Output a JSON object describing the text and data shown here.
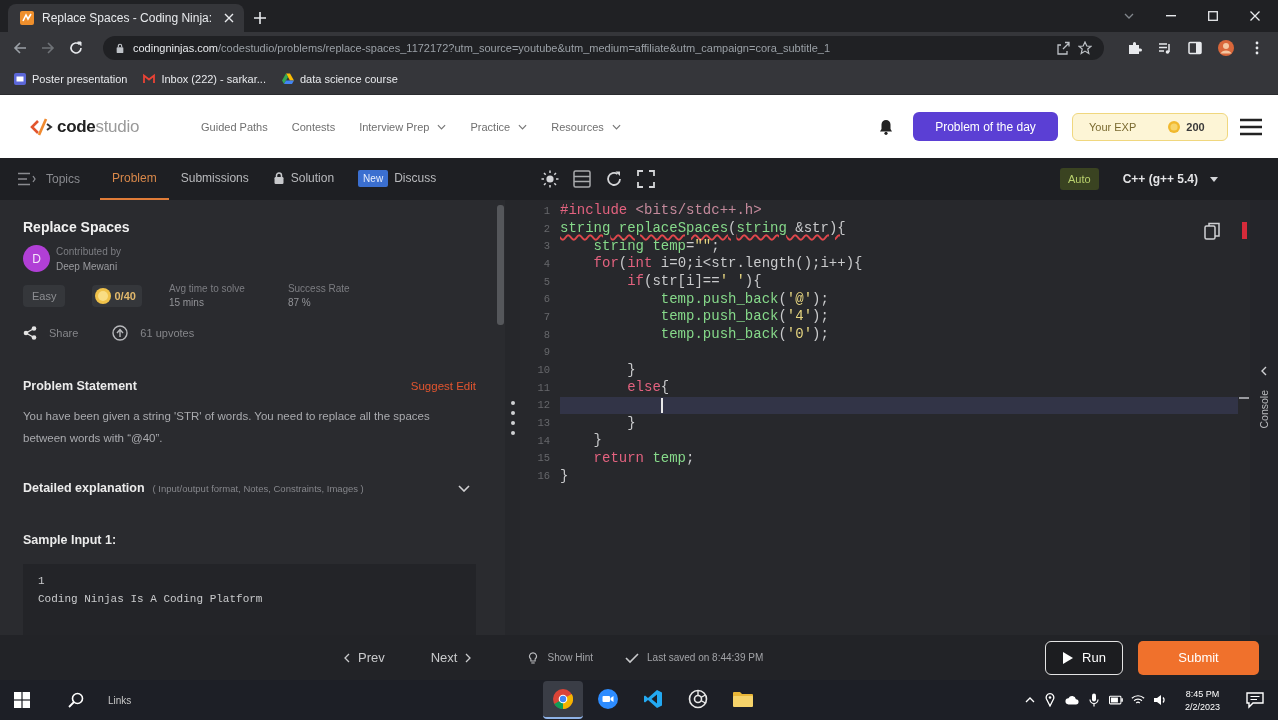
{
  "browser": {
    "tab_title": "Replace Spaces - Coding Ninja:",
    "url_host": "codingninjas.com",
    "url_path": "/codestudio/problems/replace-spaces_1172172?utm_source=youtube&utm_medium=affiliate&utm_campaign=cora_subtitle_1",
    "bookmarks": [
      {
        "label": "Poster presentation",
        "kind": "slides"
      },
      {
        "label": "Inbox (222) - sarkar...",
        "kind": "mail"
      },
      {
        "label": "data science course",
        "kind": "drive"
      }
    ]
  },
  "site_header": {
    "logo": "**code**studio",
    "nav": [
      {
        "label": "Guided Paths",
        "dropdown": false
      },
      {
        "label": "Contests",
        "dropdown": false
      },
      {
        "label": "Interview Prep",
        "dropdown": true
      },
      {
        "label": "Practice",
        "dropdown": true
      },
      {
        "label": "Resources",
        "dropdown": true
      }
    ],
    "problem_of_day": "Problem of the day",
    "exp_label": "Your EXP",
    "exp_value": "200"
  },
  "toolbar": {
    "topics": "Topics",
    "tabs": [
      {
        "label": "Problem",
        "selected": true,
        "locked": false
      },
      {
        "label": "Submissions",
        "selected": false,
        "locked": false
      },
      {
        "label": "Solution",
        "selected": false,
        "locked": true
      },
      {
        "label": "Discuss",
        "selected": false,
        "locked": false,
        "badge": "New"
      }
    ],
    "mode": "Auto",
    "language": "C++ (g++ 5.4)"
  },
  "problem": {
    "title": "Replace Spaces",
    "author": {
      "initial": "D",
      "caption": "Contributed by",
      "name": "Deep Mewani"
    },
    "difficulty": "Easy",
    "score": "0/40",
    "stats": [
      {
        "label": "Avg time to solve",
        "value": "15 mins"
      },
      {
        "label": "Success Rate",
        "value": "87 %"
      }
    ],
    "share": "Share",
    "upvotes": "61 upvotes",
    "statement_heading": "Problem Statement",
    "suggest_edit": "Suggest Edit",
    "statement": "You have been given a string 'STR' of words. You need to replace all the spaces between words with “@40”.",
    "details": {
      "label": "Detailed explanation",
      "hint": "( Input/output format, Notes, Constraints, Images )",
      "expanded": false
    },
    "sample_heading": "Sample Input 1:",
    "sample_lines": [
      "1",
      "Coding Ninjas Is A Coding Platform"
    ]
  },
  "editor": {
    "lines": [
      {
        "number": "1",
        "current": false,
        "error": false,
        "tokens": [
          {
            "text": "#include",
            "kind": "directive"
          },
          {
            "text": " <bits/stdc++.h>",
            "kind": "header"
          }
        ]
      },
      {
        "number": "2",
        "current": false,
        "error": true,
        "tokens": [
          {
            "text": "string",
            "kind": "identifier"
          },
          {
            "text": " replaceSpaces",
            "kind": "identifier"
          },
          {
            "text": "(",
            "kind": "punct"
          },
          {
            "text": "string",
            "kind": "identifier"
          },
          {
            "text": " &str){",
            "kind": "punct"
          }
        ]
      },
      {
        "number": "3",
        "current": false,
        "error": false,
        "tokens": [
          {
            "text": "    string",
            "kind": "identifier"
          },
          {
            "text": " temp",
            "kind": "identifier"
          },
          {
            "text": "=",
            "kind": "punct"
          },
          {
            "text": "\"\"",
            "kind": "string"
          },
          {
            "text": ";",
            "kind": "punct"
          }
        ]
      },
      {
        "number": "4",
        "current": false,
        "error": false,
        "tokens": [
          {
            "text": "    for",
            "kind": "keyword"
          },
          {
            "text": "(",
            "kind": "punct"
          },
          {
            "text": "int",
            "kind": "keyword"
          },
          {
            "text": " i=0;i<str.length();i++){",
            "kind": "punct"
          }
        ]
      },
      {
        "number": "5",
        "current": false,
        "error": false,
        "tokens": [
          {
            "text": "        if",
            "kind": "keyword"
          },
          {
            "text": "(str[i]==",
            "kind": "punct"
          },
          {
            "text": "' '",
            "kind": "string"
          },
          {
            "text": "){",
            "kind": "punct"
          }
        ]
      },
      {
        "number": "6",
        "current": false,
        "error": false,
        "tokens": [
          {
            "text": "            temp.push_back",
            "kind": "identifier"
          },
          {
            "text": "(",
            "kind": "punct"
          },
          {
            "text": "'@'",
            "kind": "string"
          },
          {
            "text": ");",
            "kind": "punct"
          }
        ]
      },
      {
        "number": "7",
        "current": false,
        "error": false,
        "tokens": [
          {
            "text": "            temp.push_back",
            "kind": "identifier"
          },
          {
            "text": "(",
            "kind": "punct"
          },
          {
            "text": "'4'",
            "kind": "string"
          },
          {
            "text": ");",
            "kind": "punct"
          }
        ]
      },
      {
        "number": "8",
        "current": false,
        "error": false,
        "tokens": [
          {
            "text": "            temp.push_back",
            "kind": "identifier"
          },
          {
            "text": "(",
            "kind": "punct"
          },
          {
            "text": "'0'",
            "kind": "string"
          },
          {
            "text": ");",
            "kind": "punct"
          }
        ]
      },
      {
        "number": "9",
        "current": false,
        "error": false
      },
      {
        "number": "10",
        "current": false,
        "error": false,
        "tokens": [
          {
            "text": "        }",
            "kind": "punct"
          }
        ]
      },
      {
        "number": "11",
        "current": false,
        "error": false,
        "tokens": [
          {
            "text": "        else",
            "kind": "keyword"
          },
          {
            "text": "{",
            "kind": "punct"
          }
        ]
      },
      {
        "number": "12",
        "current": true,
        "error": false
      },
      {
        "number": "13",
        "current": false,
        "error": false,
        "tokens": [
          {
            "text": "        }",
            "kind": "punct"
          }
        ]
      },
      {
        "number": "14",
        "current": false,
        "error": false,
        "tokens": [
          {
            "text": "    }",
            "kind": "punct"
          }
        ]
      },
      {
        "number": "15",
        "current": false,
        "error": false,
        "tokens": [
          {
            "text": "    return",
            "kind": "keyword"
          },
          {
            "text": " temp",
            "kind": "identifier"
          },
          {
            "text": ";",
            "kind": "punct"
          }
        ]
      },
      {
        "number": "16",
        "current": false,
        "error": false,
        "tokens": [
          {
            "text": "}",
            "kind": "punct"
          }
        ]
      }
    ],
    "console": "Console"
  },
  "footer": {
    "prev": "Prev",
    "next": "Next",
    "hint": "Show Hint",
    "saved": "Last saved on 8:44:39 PM",
    "run": "Run",
    "submit": "Submit"
  },
  "taskbar": {
    "label": "Links",
    "apps": [
      {
        "kind": "browser",
        "selected": true
      },
      {
        "kind": "camera",
        "selected": false
      },
      {
        "kind": "editor",
        "selected": false
      },
      {
        "kind": "aperture",
        "selected": false
      },
      {
        "kind": "folder",
        "selected": false
      }
    ],
    "time": "8:45 PM",
    "date": "2/2/2023"
  }
}
